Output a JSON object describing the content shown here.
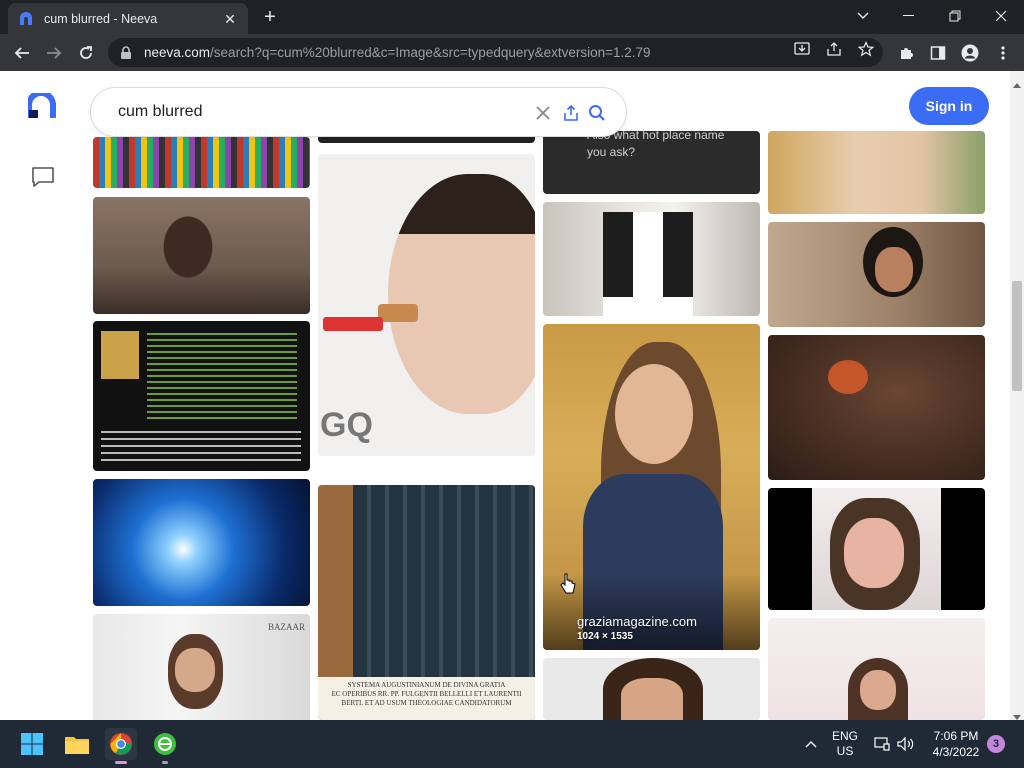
{
  "browser": {
    "tab_title": "cum blurred - Neeva",
    "url_host": "neeva.com",
    "url_path": "/search?q=cum%20blurred&c=Image&src=typedquery&extversion=1.2.79"
  },
  "search": {
    "query": "cum blurred"
  },
  "header": {
    "signin_label": "Sign in"
  },
  "results": {
    "chat_snippet": "Also what hot place name you ask?",
    "hover_source": "graziamagazine.com",
    "hover_dimensions": "1024 × 1535"
  },
  "taskbar": {
    "lang_line1": "ENG",
    "lang_line2": "US",
    "time": "7:06 PM",
    "date": "4/3/2022",
    "notification_count": "3"
  },
  "colors": {
    "accent": "#3b6cf6",
    "chrome_dark": "#202124",
    "chrome_toolbar": "#35363a",
    "taskbar": "#1f2a36"
  }
}
